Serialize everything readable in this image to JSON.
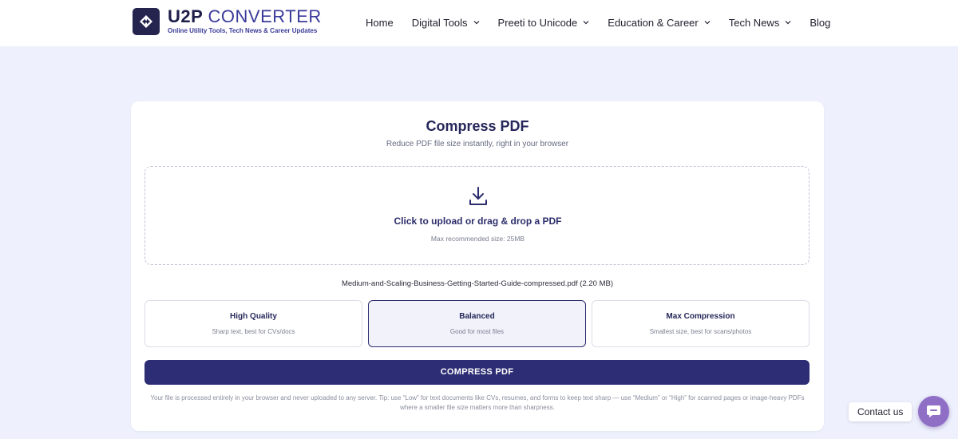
{
  "brand": {
    "name_bold": "U2P",
    "name_light": "CONVERTER",
    "tagline": "Online Utility Tools, Tech News & Career Updates"
  },
  "nav": {
    "items": [
      {
        "label": "Home",
        "dropdown": false
      },
      {
        "label": "Digital Tools",
        "dropdown": true
      },
      {
        "label": "Preeti to Unicode",
        "dropdown": true
      },
      {
        "label": "Education & Career",
        "dropdown": true
      },
      {
        "label": "Tech News",
        "dropdown": true
      },
      {
        "label": "Blog",
        "dropdown": false
      }
    ]
  },
  "tool": {
    "title": "Compress PDF",
    "subtitle": "Reduce PDF file size instantly, right in your browser",
    "dropzone": {
      "icon": "download-icon",
      "main_text": "Click to upload or drag & drop a PDF",
      "sub_text": "Max recommended size: 25MB"
    },
    "file_info": "Medium-and-Scaling-Business-Getting-Started-Guide-compressed.pdf (2.20 MB)",
    "options": [
      {
        "label": "High Quality",
        "description": "Sharp text, best for CVs/docs",
        "selected": false
      },
      {
        "label": "Balanced",
        "description": "Good for most files",
        "selected": true
      },
      {
        "label": "Max Compression",
        "description": "Smallest size, best for scans/photos",
        "selected": false
      }
    ],
    "compress_button": "COMPRESS PDF",
    "note": "Your file is processed entirely in your browser and never uploaded to any server. Tip: use “Low” for text documents like CVs, resumes, and forms to keep text sharp — use “Medium” or “High” for scanned pages or image-heavy PDFs where a smaller file size matters more than sharpness."
  },
  "contact": {
    "label": "Contact us",
    "icon": "chat-bubble-icon"
  },
  "colors": {
    "page_bg": "#eef1fd",
    "accent": "#2c2d74",
    "brand_dark": "#24244f",
    "chat_button": "#8f6fc6"
  }
}
